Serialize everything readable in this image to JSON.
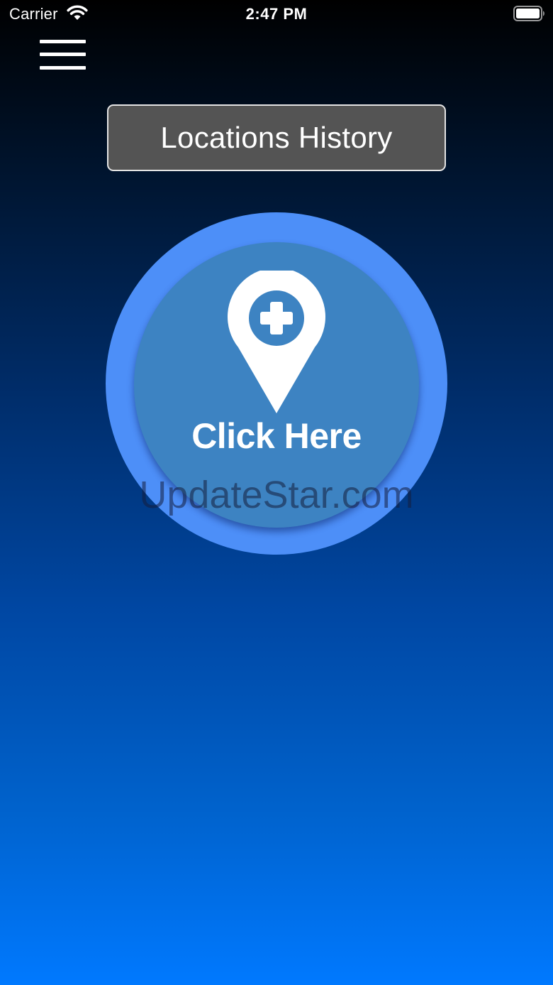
{
  "status_bar": {
    "carrier": "Carrier",
    "time": "2:47 PM",
    "icons": [
      "wifi-icon",
      "battery-icon"
    ]
  },
  "header": {
    "menu_icon": "hamburger-menu-icon"
  },
  "history_button": {
    "label": "Locations History"
  },
  "main_action": {
    "icon": "map-pin-plus-icon",
    "label": "Click Here"
  },
  "watermark": {
    "text": "UpdateStar.com"
  },
  "colors": {
    "background_top": "#000000",
    "background_bottom": "#0079ff",
    "button_background": "#545454",
    "button_border": "#e4e4e4",
    "outer_circle": "#4d8ff8",
    "inner_circle": "#3d83c2",
    "text": "#ffffff"
  }
}
